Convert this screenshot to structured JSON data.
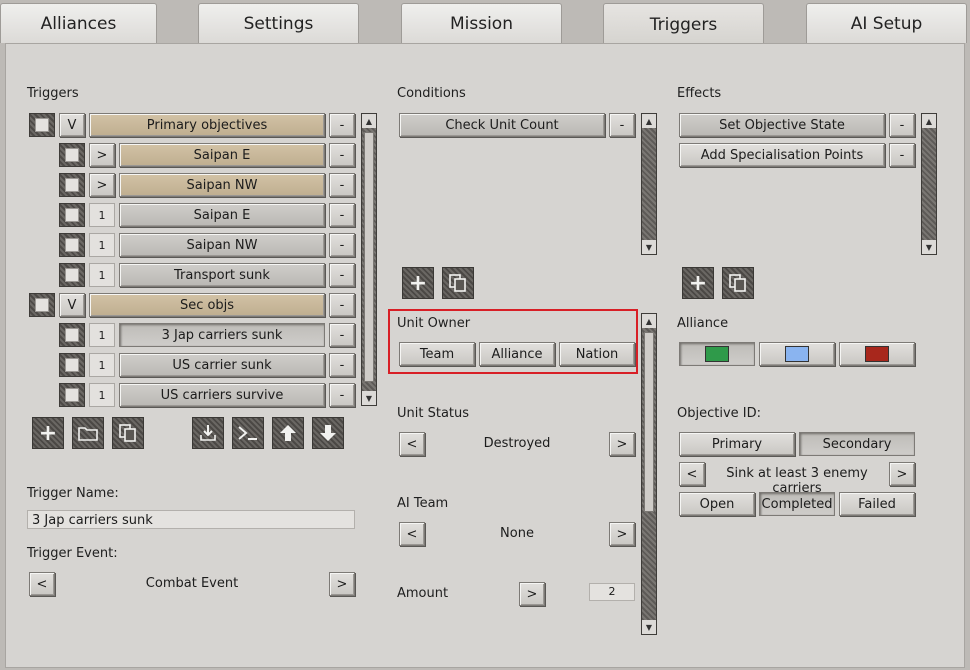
{
  "tabs": [
    "Alliances",
    "Settings",
    "Mission",
    "Triggers",
    "AI Setup"
  ],
  "active_tab": "Triggers",
  "triggers": {
    "heading": "Triggers",
    "rows": [
      {
        "expander": "V",
        "label": "Primary objectives",
        "style": "tan"
      },
      {
        "expander": ">",
        "label": "Saipan E",
        "style": "tan"
      },
      {
        "expander": ">",
        "label": "Saipan NW",
        "style": "tan"
      },
      {
        "expander": "1",
        "label": "Saipan E",
        "style": "gray"
      },
      {
        "expander": "1",
        "label": "Saipan NW",
        "style": "gray"
      },
      {
        "expander": "1",
        "label": "Transport sunk",
        "style": "gray"
      },
      {
        "expander": "V",
        "label": "Sec objs",
        "style": "tan"
      },
      {
        "expander": "1",
        "label": "3 Jap carriers sunk",
        "style": "gray"
      },
      {
        "expander": "1",
        "label": "US carrier sunk",
        "style": "gray"
      },
      {
        "expander": "1",
        "label": "US carriers survive",
        "style": "gray"
      }
    ],
    "remove_label": "-",
    "trigger_name_label": "Trigger Name:",
    "trigger_name_value": "3 Jap carriers sunk",
    "trigger_event_label": "Trigger Event:",
    "trigger_event_value": "Combat Event",
    "prev": "<",
    "next": ">"
  },
  "conditions": {
    "heading": "Conditions",
    "items": [
      "Check Unit Count"
    ],
    "unit_owner_label": "Unit Owner",
    "unit_owner_options": [
      "Team",
      "Alliance",
      "Nation"
    ],
    "unit_status_label": "Unit Status",
    "unit_status_value": "Destroyed",
    "ai_team_label": "AI Team",
    "ai_team_value": "None",
    "amount_label": "Amount",
    "amount_value": "2"
  },
  "effects": {
    "heading": "Effects",
    "items": [
      "Set Objective State",
      "Add Specialisation Points"
    ],
    "alliance_label": "Alliance",
    "alliance_colors": [
      "#2f9a4a",
      "#8ab4f0",
      "#a8271c"
    ],
    "objective_id_label": "Objective ID:",
    "objective_types": [
      "Primary",
      "Secondary"
    ],
    "objective_value": "Sink at least 3 enemy carriers",
    "states": [
      "Open",
      "Completed",
      "Failed"
    ]
  }
}
